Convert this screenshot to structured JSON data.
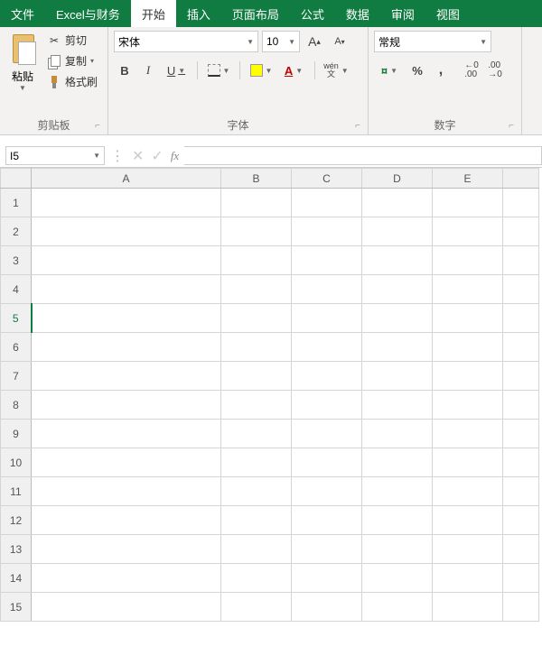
{
  "menu": {
    "file": "文件",
    "excel_finance": "Excel与财务",
    "home": "开始",
    "insert": "插入",
    "page_layout": "页面布局",
    "formulas": "公式",
    "data": "数据",
    "review": "审阅",
    "view": "视图"
  },
  "ribbon": {
    "clipboard": {
      "paste": "粘贴",
      "cut": "剪切",
      "copy": "复制",
      "format_painter": "格式刷",
      "group_label": "剪贴板"
    },
    "font": {
      "name": "宋体",
      "size": "10",
      "group_label": "字体",
      "wen_top": "wén",
      "wen_bottom": "文"
    },
    "number": {
      "format": "常规",
      "group_label": "数字"
    }
  },
  "formula_bar": {
    "name_box": "I5",
    "fx": "fx",
    "value": ""
  },
  "grid": {
    "columns": [
      "A",
      "B",
      "C",
      "D",
      "E"
    ],
    "rows": [
      "1",
      "2",
      "3",
      "4",
      "5",
      "6",
      "7",
      "8",
      "9",
      "10",
      "11",
      "12",
      "13",
      "14",
      "15"
    ],
    "selected_row": "5"
  }
}
